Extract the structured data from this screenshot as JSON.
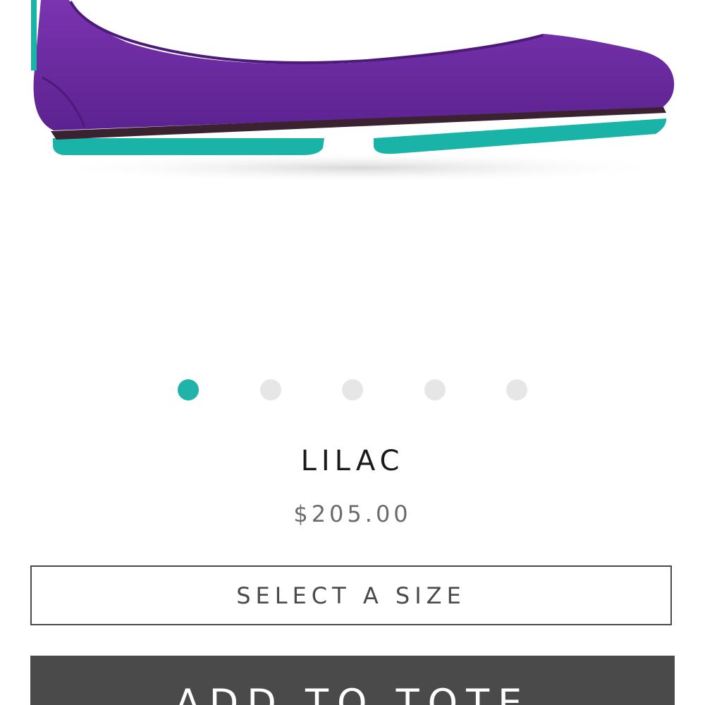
{
  "product": {
    "name": "LILAC",
    "price": "$205.00",
    "image_alt": "Purple ballet flat with turquoise sole",
    "colors": {
      "upper": "#6b2a9e",
      "sole": "#19b3a8"
    }
  },
  "carousel": {
    "count": 5,
    "active_index": 0,
    "active_color": "#1fb3aa",
    "inactive_color": "#e6e6e6"
  },
  "actions": {
    "size_label": "SELECT A SIZE",
    "add_label": "ADD TO TOTE"
  }
}
